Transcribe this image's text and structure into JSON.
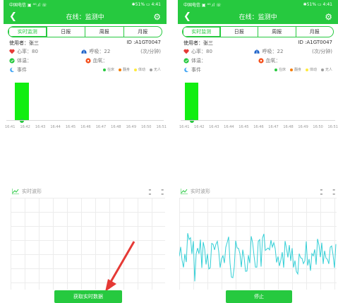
{
  "left": {
    "status_left": "中国电信 ▣ ⁴ᴳ.ıl ☏",
    "status_right": "✱51% ▭ 4:41",
    "title": "在线：监测中",
    "tabs": [
      "实时监测",
      "日报",
      "周报",
      "月报"
    ],
    "user_label": "使用者：张三",
    "id_label": "ID :A1GT0047",
    "heart_label": "心率：80",
    "breath_label": "呼吸：22",
    "breath_unit": "(次/分钟)",
    "temp_label": "体温：",
    "oxygen_label": "血氧：",
    "event_label": "事件",
    "legend": [
      "在床",
      "翻身",
      "体动",
      "无人"
    ],
    "xticks": [
      "16:41",
      "16:42",
      "16:43",
      "16:44",
      "16:45",
      "16:46",
      "16:47",
      "16:48",
      "16:49",
      "16:50",
      "16:51"
    ],
    "wave_title": "实时波形",
    "button": "获取实时数据"
  },
  "right": {
    "status_left": "中国电信 ▣ ⁴ᴳ.ıl ☏",
    "status_right": "✱51% ▭ 4:41",
    "title": "在线：监测中",
    "tabs": [
      "实时监测",
      "日报",
      "周报",
      "月报"
    ],
    "user_label": "使用者：张三",
    "id_label": "ID :A1GT0047",
    "heart_label": "心率：80",
    "breath_label": "呼吸：22",
    "breath_unit": "(次/分钟)",
    "temp_label": "体温：",
    "oxygen_label": "血氧：",
    "event_label": "事件",
    "legend": [
      "在床",
      "翻身",
      "体动",
      "无人"
    ],
    "xticks": [
      "16:41",
      "16:42",
      "16:43",
      "16:44",
      "16:45",
      "16:46",
      "16:47",
      "16:48",
      "16:49",
      "16:50",
      "16:51"
    ],
    "wave_title": "实时波形",
    "button": "停止"
  },
  "colors": {
    "accent": "#26c93f",
    "bar": "#11ee11",
    "wave": "#33cfd6",
    "arrow": "#e53935",
    "legend": [
      "#26c93f",
      "#f57c00",
      "#ffeb3b",
      "#9e9e9e"
    ]
  }
}
